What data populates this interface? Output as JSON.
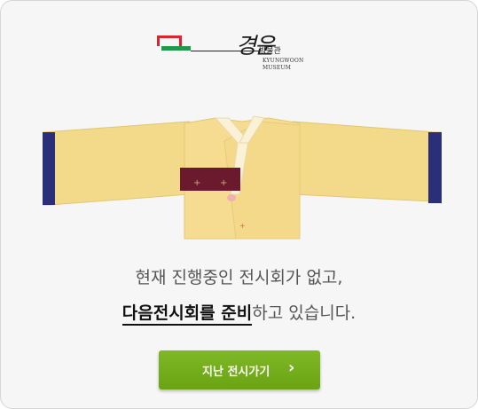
{
  "logo": {
    "hangul": "경운",
    "korean_small": "박물관",
    "english_line1": "KYUNGWOON",
    "english_line2": "MUSEUM"
  },
  "notice": {
    "line1": "현재 진행중인 전시회가 없고,",
    "line2_emphasis": "다음전시회를 준비",
    "line2_rest": "하고 있습니다."
  },
  "button": {
    "label": "지난 전시가기",
    "icon": "chevron-right-icon"
  },
  "colors": {
    "background": "#f6f6f6",
    "button_green": "#72ac1b",
    "garment_yellow": "#f3d98a",
    "sleeve_navy": "#2a2f7a",
    "ribbon_maroon": "#6b1a2d",
    "logo_red": "#d9252b",
    "logo_green": "#1e9a4a"
  }
}
